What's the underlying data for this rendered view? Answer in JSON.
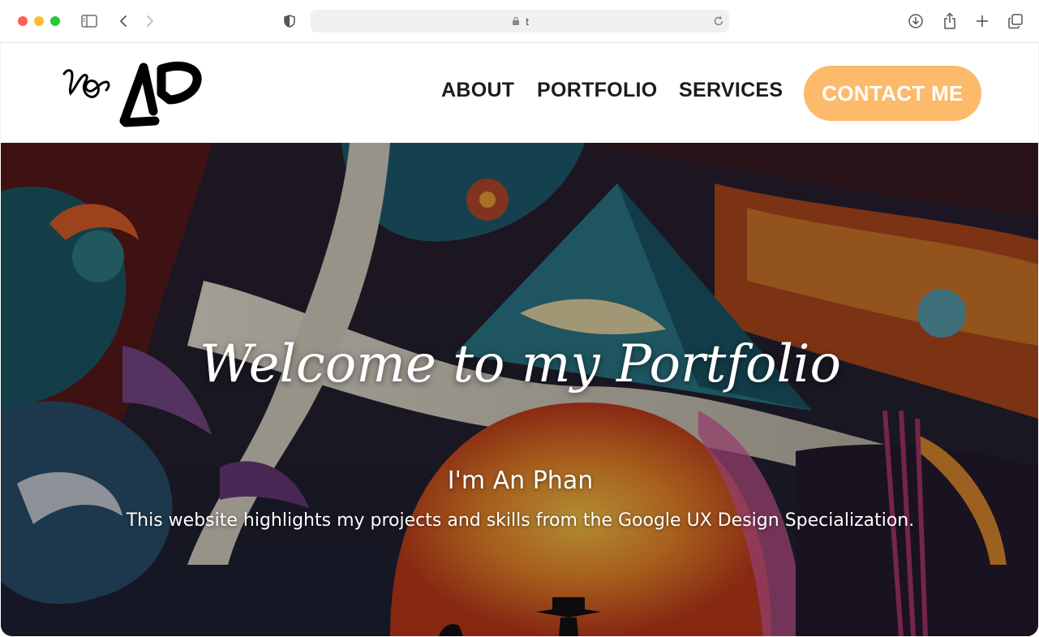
{
  "browser": {
    "url": "t",
    "icons": [
      "sidebar-icon",
      "back-icon",
      "forward-icon",
      "shield-icon",
      "lock-icon",
      "reload-icon",
      "download-icon",
      "share-icon",
      "new-tab-icon",
      "tabs-overview-icon"
    ]
  },
  "header": {
    "logo_text": "AP",
    "nav": {
      "about": "ABOUT",
      "portfolio": "PORTFOLIO",
      "services": "SERVICES"
    },
    "contact_label": "CONTACT ME",
    "accent_color": "#fcba6a"
  },
  "hero": {
    "title": "Welcome to my Portfolio",
    "name": "I'm An Phan",
    "description": "This website highlights my projects and skills from the Google UX Design Specialization."
  }
}
